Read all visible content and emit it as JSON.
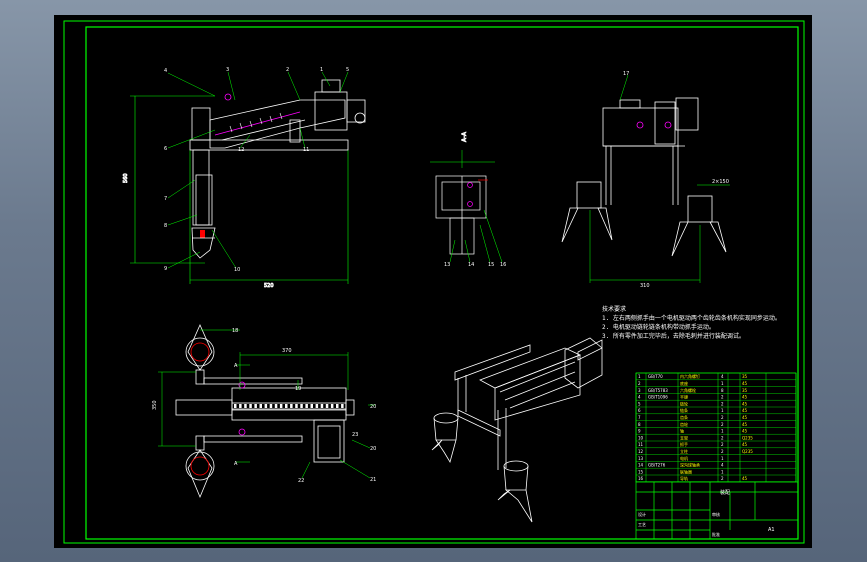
{
  "drawing": {
    "section_label": "A-A",
    "tech_requirements_title": "技术要求",
    "tech_requirements": [
      "1. 左右两侧抓手由一个电机驱动两个齿轮齿条机构实现同步运动。",
      "2. 电机驱动链轮链条机构带动抓手运动。",
      "3. 所有零件加工完毕后，去除毛刺并进行装配调试。"
    ],
    "sheet_size": "A1",
    "title_block_name": "装配",
    "title_block_labels": [
      "设计",
      "审核",
      "工艺",
      "批准"
    ]
  },
  "colors": {
    "background": "#000000",
    "frame": "#00ff00",
    "geometry": "#ffffff",
    "dimension": "#00ff00",
    "leader": "#00ff00",
    "highlight": "#ff00ff",
    "hidden": "#ff0000"
  },
  "parts_list_rows": [
    {
      "no": "1",
      "code": "GB/T70",
      "name": "内六角螺钉",
      "qty": "4",
      "mat": "35"
    },
    {
      "no": "2",
      "code": "",
      "name": "底座",
      "qty": "1",
      "mat": "45"
    },
    {
      "no": "3",
      "code": "GB/T5783",
      "name": "六角螺栓",
      "qty": "8",
      "mat": "35"
    },
    {
      "no": "4",
      "code": "GB/T1096",
      "name": "平键",
      "qty": "2",
      "mat": "45"
    },
    {
      "no": "5",
      "code": "",
      "name": "链轮",
      "qty": "2",
      "mat": "45"
    },
    {
      "no": "6",
      "code": "",
      "name": "链条",
      "qty": "1",
      "mat": "45"
    },
    {
      "no": "7",
      "code": "",
      "name": "齿条",
      "qty": "2",
      "mat": "45"
    },
    {
      "no": "8",
      "code": "",
      "name": "齿轮",
      "qty": "2",
      "mat": "45"
    },
    {
      "no": "9",
      "code": "",
      "name": "轴",
      "qty": "1",
      "mat": "45"
    },
    {
      "no": "10",
      "code": "",
      "name": "支架",
      "qty": "2",
      "mat": "Q235"
    },
    {
      "no": "11",
      "code": "",
      "name": "抓手",
      "qty": "2",
      "mat": "45"
    },
    {
      "no": "12",
      "code": "",
      "name": "立柱",
      "qty": "2",
      "mat": "Q235"
    },
    {
      "no": "13",
      "code": "",
      "name": "电机",
      "qty": "1",
      "mat": ""
    },
    {
      "no": "14",
      "code": "GB/T276",
      "name": "深沟球轴承",
      "qty": "4",
      "mat": ""
    },
    {
      "no": "15",
      "code": "",
      "name": "联轴器",
      "qty": "1",
      "mat": ""
    },
    {
      "no": "16",
      "code": "",
      "name": "导轨",
      "qty": "2",
      "mat": "45"
    }
  ],
  "balloons": {
    "front_view": [
      "4",
      "3",
      "2",
      "1",
      "5",
      "6",
      "7",
      "8",
      "9",
      "10",
      "11",
      "12"
    ],
    "side_view_small": [
      "13",
      "14",
      "15",
      "16"
    ],
    "side_view": [
      "17"
    ],
    "top_view": [
      "18",
      "19",
      "20",
      "21",
      "22",
      "23"
    ]
  },
  "dimensions": {
    "front_height": "560",
    "front_width": "520",
    "side_width": "310",
    "side_offset": "2×150",
    "top_width": "350",
    "top_span": "370",
    "top_small": "20"
  },
  "section_markers": [
    "A",
    "A"
  ]
}
